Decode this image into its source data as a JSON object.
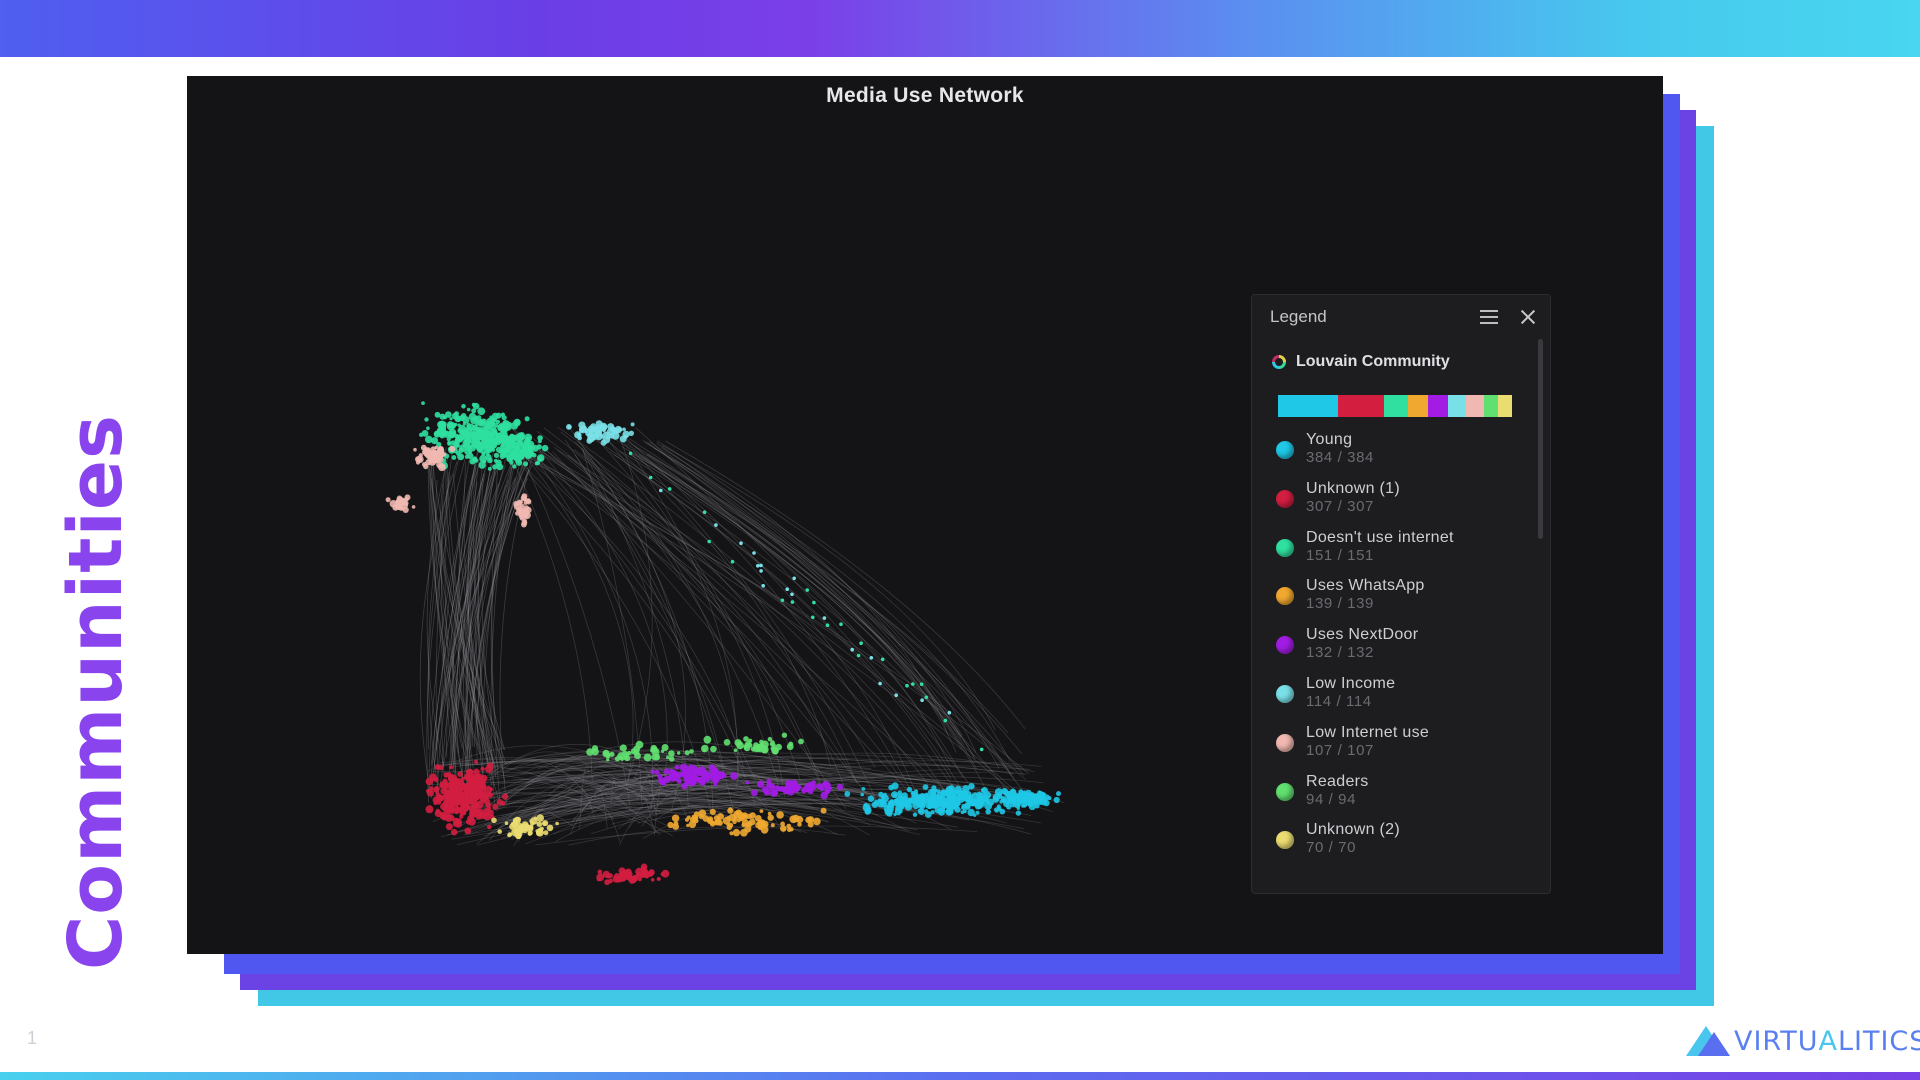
{
  "slide": {
    "side_title": "Communities",
    "page_number": "1",
    "brand": {
      "part1": "VIRTU",
      "part2": "A",
      "part3": "LITICS"
    }
  },
  "viz": {
    "title": "Media Use Network"
  },
  "legend": {
    "title": "Legend",
    "attribute": "Louvain Community",
    "items": [
      {
        "name": "Young",
        "count": "384 / 384",
        "color": "#1ec8e6"
      },
      {
        "name": "Unknown (1)",
        "count": "307 / 307",
        "color": "#d31e40"
      },
      {
        "name": "Doesn't use internet",
        "count": "151 / 151",
        "color": "#2fe0a0"
      },
      {
        "name": "Uses WhatsApp",
        "count": "139 / 139",
        "color": "#f0a830"
      },
      {
        "name": "Uses NextDoor",
        "count": "132 / 132",
        "color": "#a21ce4"
      },
      {
        "name": "Low Income",
        "count": "114 / 114",
        "color": "#7ae0e8"
      },
      {
        "name": "Low Internet use",
        "count": "107 / 107",
        "color": "#f0b8b0"
      },
      {
        "name": "Readers",
        "count": "94 / 94",
        "color": "#60e070"
      },
      {
        "name": "Unknown (2)",
        "count": "70 / 70",
        "color": "#eadc70"
      }
    ]
  },
  "colors": {
    "edge": "#8a8a90",
    "panel": "#141416",
    "accent_purple": "#8a44ee"
  }
}
